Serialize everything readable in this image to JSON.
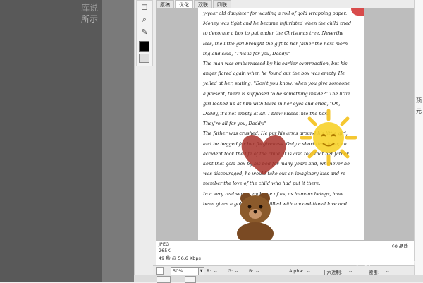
{
  "background": {
    "faint_line1": "库说",
    "faint_line2": "所示"
  },
  "toolbar": {
    "tools": [
      "hand-tool",
      "zoom-tool",
      "eyedropper-tool"
    ],
    "icons": [
      "◻",
      "⌕",
      "✎"
    ],
    "foreground_color": "#000000"
  },
  "tabs": [
    {
      "label": "原稿",
      "active": false
    },
    {
      "label": "优化",
      "active": true
    },
    {
      "label": "双联",
      "active": false
    },
    {
      "label": "四联",
      "active": false
    }
  ],
  "letter": {
    "lines": [
      "y-year old daughter for wasting a roll of gold wrapping paper.",
      "Money was tight and he became infuriated when the child tried",
      "to decorate a box to put under the Christmas tree. Neverthe",
      "less, the little girl brought the gift to her father the next morn",
      "ing and said, \"This is for you, Daddy.\"",
      "The man was embarrassed by his earlier overreaction, but his",
      "anger flared again when he found out the box was empty. He",
      "yelled at her, stating, \"Don't you know, when you give someone",
      "a present, there is supposed to be something inside?\" The little",
      "girl looked up at him with tears in her eyes and cried, \"Oh,",
      "Daddy, it's not empty at all. I blew kisses into the box.",
      "They're all for you, Daddy.\"",
      "The father was crushed. He put his arms around his little girl,",
      "and he begged for her forgiveness. Only a short time later, an",
      "accident took the life of the child. It is also told that her father",
      "kept that gold box by his bed for many years and, whenever he",
      "was discouraged, he would take out an imaginary kiss and re",
      "member the love of the child who had put it there.",
      "In a very real sense, each one of us, as humans beings, have",
      "been given a gold container filled with unconditional love and"
    ]
  },
  "info": {
    "format": "JPEG",
    "size": "265K",
    "time": "49 秒 @ 56.6 Kbps",
    "quality": "60 品质"
  },
  "statusbar": {
    "zoom": "50%",
    "r_label": "R:",
    "r_value": "--",
    "g_label": "G:",
    "g_value": "--",
    "b_label": "B:",
    "b_value": "--",
    "alpha_label": "Alpha:",
    "alpha_value": "--",
    "hex_label": "十六进制:",
    "hex_value": "--",
    "index_label": "索引:",
    "index_value": "--"
  },
  "right_strip": {
    "label1": "预",
    "label2": "元"
  },
  "watermark": {
    "brand": "Bai 经验",
    "url": "jingyan.baidu.com"
  }
}
